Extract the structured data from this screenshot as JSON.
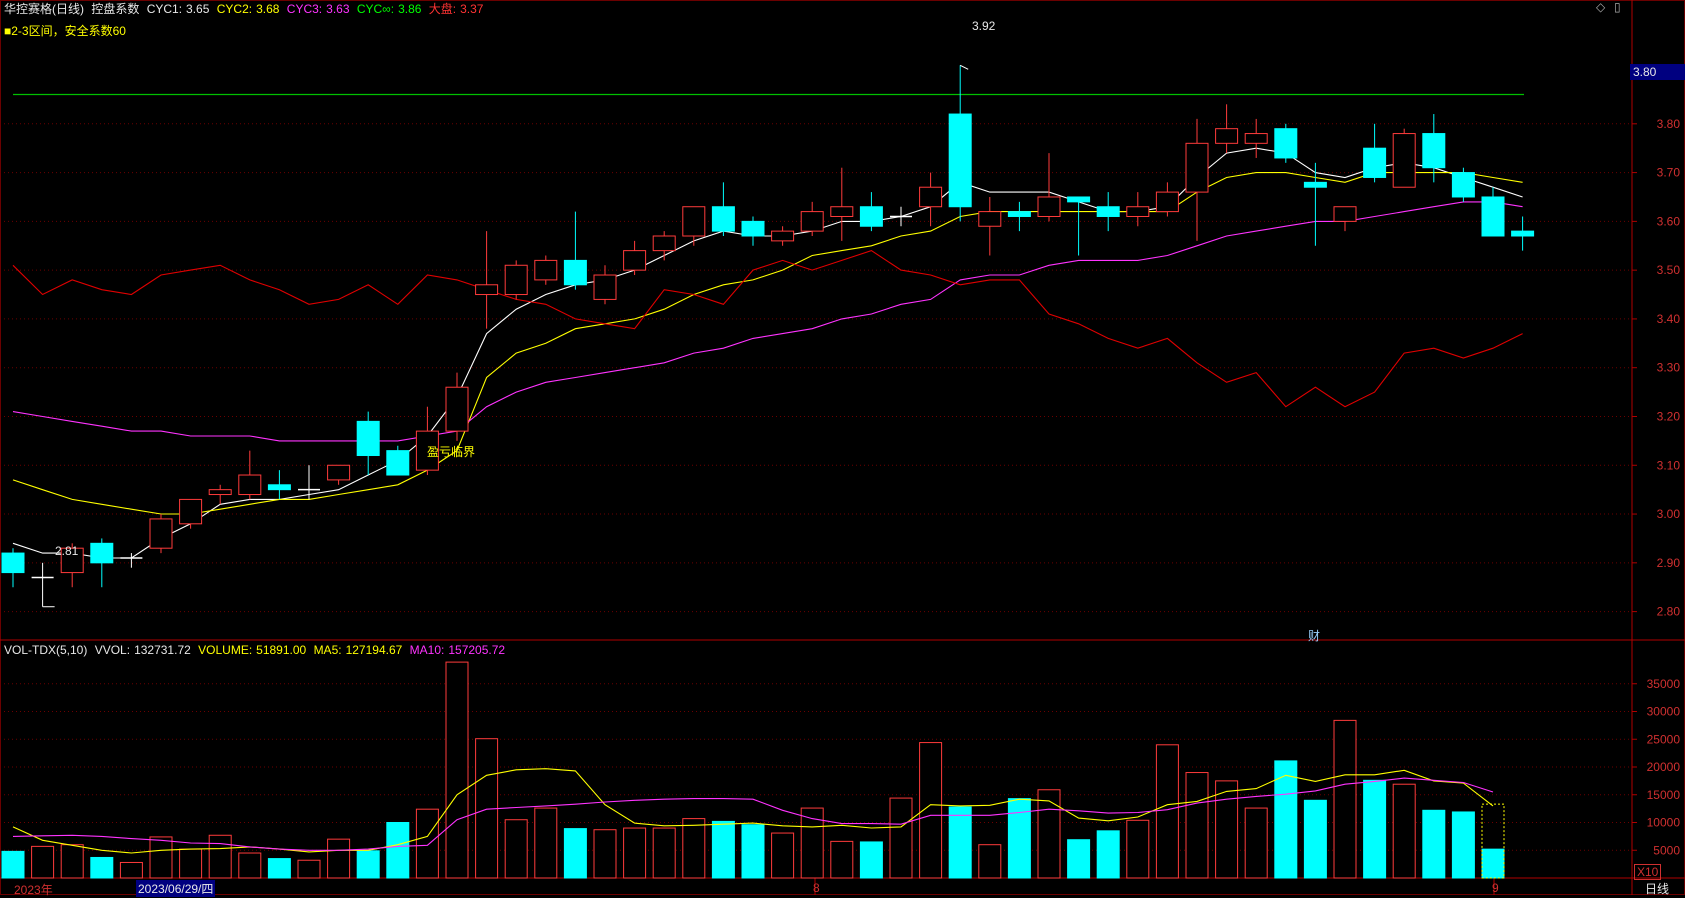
{
  "header": {
    "stock": "华控赛格(日线)",
    "indicator": "控盘系数",
    "cyc1_label": "CYC1:",
    "cyc1": "3.65",
    "cyc2_label": "CYC2:",
    "cyc2": "3.68",
    "cyc3_label": "CYC3:",
    "cyc3": "3.63",
    "cycinf_label": "CYC∞:",
    "cycinf": "3.86",
    "dapan_label": "大盘:",
    "dapan": "3.37",
    "zone_note": "■2-3区间，安全系数60"
  },
  "vol_header": {
    "name": "VOL-TDX(5,10)",
    "vvol_label": "VVOL:",
    "vvol": "132731.72",
    "volume_label": "VOLUME:",
    "volume": "51891.00",
    "ma5_label": "MA5:",
    "ma5": "127194.67",
    "ma10_label": "MA10:",
    "ma10": "157205.72"
  },
  "annotations": {
    "breakeven": "盈亏临界",
    "high_label": "3.92",
    "low_label": "2.81",
    "cai": "财",
    "price_tag": "3.80",
    "x10": "X10",
    "period": "日线",
    "year": "2023年",
    "cursor_date": "2023/06/29/四",
    "month_8": "8",
    "month_9": "9"
  },
  "colors": {
    "up": "#ff3b3b",
    "down": "#00ffff",
    "ma5": "#ffffff",
    "ma10": "#ffff00",
    "ma_long": "#ff33ff",
    "index": "#e00000",
    "hline": "#00c000",
    "grid": "#6b0000",
    "axis_text": "#d03030"
  },
  "chart_data": [
    {
      "type": "candlestick",
      "title": "",
      "ylim": [
        2.75,
        3.98
      ],
      "y_ticks": [
        2.8,
        2.9,
        3.0,
        3.1,
        3.2,
        3.3,
        3.4,
        3.5,
        3.6,
        3.7,
        3.8
      ],
      "reference_line": 3.86,
      "candles": [
        {
          "o": 2.92,
          "h": 2.93,
          "l": 2.85,
          "c": 2.88
        },
        {
          "o": 2.87,
          "h": 2.9,
          "l": 2.81,
          "c": 2.87
        },
        {
          "o": 2.88,
          "h": 2.94,
          "l": 2.85,
          "c": 2.93
        },
        {
          "o": 2.94,
          "h": 2.95,
          "l": 2.85,
          "c": 2.9
        },
        {
          "o": 2.91,
          "h": 2.92,
          "l": 2.89,
          "c": 2.91
        },
        {
          "o": 2.93,
          "h": 3.0,
          "l": 2.92,
          "c": 2.99
        },
        {
          "o": 2.98,
          "h": 3.03,
          "l": 2.97,
          "c": 3.03
        },
        {
          "o": 3.04,
          "h": 3.06,
          "l": 3.02,
          "c": 3.05
        },
        {
          "o": 3.04,
          "h": 3.13,
          "l": 3.03,
          "c": 3.08
        },
        {
          "o": 3.06,
          "h": 3.09,
          "l": 3.03,
          "c": 3.05
        },
        {
          "o": 3.05,
          "h": 3.1,
          "l": 3.03,
          "c": 3.05
        },
        {
          "o": 3.07,
          "h": 3.1,
          "l": 3.06,
          "c": 3.1
        },
        {
          "o": 3.19,
          "h": 3.21,
          "l": 3.08,
          "c": 3.12
        },
        {
          "o": 3.13,
          "h": 3.14,
          "l": 3.08,
          "c": 3.08
        },
        {
          "o": 3.09,
          "h": 3.22,
          "l": 3.08,
          "c": 3.17
        },
        {
          "o": 3.17,
          "h": 3.29,
          "l": 3.15,
          "c": 3.26
        },
        {
          "o": 3.45,
          "h": 3.58,
          "l": 3.38,
          "c": 3.47
        },
        {
          "o": 3.45,
          "h": 3.52,
          "l": 3.44,
          "c": 3.51
        },
        {
          "o": 3.48,
          "h": 3.53,
          "l": 3.47,
          "c": 3.52
        },
        {
          "o": 3.52,
          "h": 3.62,
          "l": 3.46,
          "c": 3.47
        },
        {
          "o": 3.44,
          "h": 3.51,
          "l": 3.43,
          "c": 3.49
        },
        {
          "o": 3.5,
          "h": 3.56,
          "l": 3.49,
          "c": 3.54
        },
        {
          "o": 3.54,
          "h": 3.58,
          "l": 3.52,
          "c": 3.57
        },
        {
          "o": 3.57,
          "h": 3.63,
          "l": 3.55,
          "c": 3.63
        },
        {
          "o": 3.63,
          "h": 3.68,
          "l": 3.57,
          "c": 3.58
        },
        {
          "o": 3.6,
          "h": 3.61,
          "l": 3.55,
          "c": 3.57
        },
        {
          "o": 3.56,
          "h": 3.59,
          "l": 3.55,
          "c": 3.58
        },
        {
          "o": 3.58,
          "h": 3.64,
          "l": 3.57,
          "c": 3.62
        },
        {
          "o": 3.61,
          "h": 3.71,
          "l": 3.56,
          "c": 3.63
        },
        {
          "o": 3.63,
          "h": 3.66,
          "l": 3.58,
          "c": 3.59
        },
        {
          "o": 3.61,
          "h": 3.63,
          "l": 3.59,
          "c": 3.61
        },
        {
          "o": 3.63,
          "h": 3.7,
          "l": 3.59,
          "c": 3.67
        },
        {
          "o": 3.82,
          "h": 3.92,
          "l": 3.6,
          "c": 3.63
        },
        {
          "o": 3.59,
          "h": 3.65,
          "l": 3.53,
          "c": 3.62
        },
        {
          "o": 3.62,
          "h": 3.64,
          "l": 3.58,
          "c": 3.61
        },
        {
          "o": 3.61,
          "h": 3.74,
          "l": 3.6,
          "c": 3.65
        },
        {
          "o": 3.65,
          "h": 3.65,
          "l": 3.53,
          "c": 3.64
        },
        {
          "o": 3.63,
          "h": 3.66,
          "l": 3.58,
          "c": 3.61
        },
        {
          "o": 3.61,
          "h": 3.66,
          "l": 3.59,
          "c": 3.63
        },
        {
          "o": 3.62,
          "h": 3.68,
          "l": 3.61,
          "c": 3.66
        },
        {
          "o": 3.66,
          "h": 3.81,
          "l": 3.56,
          "c": 3.76
        },
        {
          "o": 3.76,
          "h": 3.84,
          "l": 3.74,
          "c": 3.79
        },
        {
          "o": 3.76,
          "h": 3.81,
          "l": 3.73,
          "c": 3.78
        },
        {
          "o": 3.79,
          "h": 3.8,
          "l": 3.72,
          "c": 3.73
        },
        {
          "o": 3.68,
          "h": 3.72,
          "l": 3.55,
          "c": 3.67
        },
        {
          "o": 3.6,
          "h": 3.63,
          "l": 3.58,
          "c": 3.63
        },
        {
          "o": 3.75,
          "h": 3.8,
          "l": 3.68,
          "c": 3.69
        },
        {
          "o": 3.67,
          "h": 3.79,
          "l": 3.67,
          "c": 3.78
        },
        {
          "o": 3.78,
          "h": 3.82,
          "l": 3.68,
          "c": 3.71
        },
        {
          "o": 3.7,
          "h": 3.71,
          "l": 3.64,
          "c": 3.65
        },
        {
          "o": 3.65,
          "h": 3.67,
          "l": 3.58,
          "c": 3.57
        },
        {
          "o": 3.58,
          "h": 3.61,
          "l": 3.54,
          "c": 3.57
        }
      ],
      "series": [
        {
          "name": "CYC1",
          "values": [
            2.94,
            2.92,
            2.92,
            2.91,
            2.91,
            2.95,
            2.98,
            3.02,
            3.03,
            3.03,
            3.04,
            3.05,
            3.08,
            3.11,
            3.16,
            3.24,
            3.37,
            3.42,
            3.45,
            3.47,
            3.48,
            3.5,
            3.53,
            3.56,
            3.58,
            3.57,
            3.57,
            3.58,
            3.6,
            3.6,
            3.61,
            3.63,
            3.68,
            3.66,
            3.66,
            3.66,
            3.64,
            3.62,
            3.62,
            3.63,
            3.69,
            3.74,
            3.75,
            3.74,
            3.7,
            3.69,
            3.71,
            3.72,
            3.71,
            3.69,
            3.67,
            3.65
          ]
        },
        {
          "name": "CYC2",
          "values": [
            3.07,
            3.05,
            3.03,
            3.02,
            3.01,
            3.0,
            3.0,
            3.01,
            3.02,
            3.03,
            3.03,
            3.04,
            3.05,
            3.06,
            3.09,
            3.13,
            3.28,
            3.33,
            3.35,
            3.38,
            3.39,
            3.4,
            3.42,
            3.45,
            3.47,
            3.48,
            3.5,
            3.53,
            3.54,
            3.55,
            3.57,
            3.58,
            3.61,
            3.62,
            3.62,
            3.62,
            3.62,
            3.62,
            3.62,
            3.62,
            3.66,
            3.69,
            3.7,
            3.7,
            3.69,
            3.68,
            3.7,
            3.7,
            3.7,
            3.7,
            3.69,
            3.68
          ]
        },
        {
          "name": "CYC3",
          "values": [
            3.21,
            3.2,
            3.19,
            3.18,
            3.17,
            3.17,
            3.16,
            3.16,
            3.16,
            3.15,
            3.15,
            3.15,
            3.15,
            3.15,
            3.16,
            3.17,
            3.22,
            3.25,
            3.27,
            3.28,
            3.29,
            3.3,
            3.31,
            3.33,
            3.34,
            3.36,
            3.37,
            3.38,
            3.4,
            3.41,
            3.43,
            3.44,
            3.48,
            3.49,
            3.49,
            3.51,
            3.52,
            3.52,
            3.52,
            3.53,
            3.55,
            3.57,
            3.58,
            3.59,
            3.6,
            3.6,
            3.61,
            3.62,
            3.63,
            3.64,
            3.64,
            3.63
          ]
        },
        {
          "name": "大盘",
          "values": [
            3.51,
            3.45,
            3.48,
            3.46,
            3.45,
            3.49,
            3.5,
            3.51,
            3.48,
            3.46,
            3.43,
            3.44,
            3.47,
            3.43,
            3.49,
            3.48,
            3.46,
            3.44,
            3.43,
            3.4,
            3.39,
            3.38,
            3.46,
            3.45,
            3.43,
            3.5,
            3.52,
            3.5,
            3.52,
            3.54,
            3.5,
            3.49,
            3.47,
            3.48,
            3.48,
            3.41,
            3.39,
            3.36,
            3.34,
            3.36,
            3.31,
            3.27,
            3.29,
            3.22,
            3.26,
            3.22,
            3.25,
            3.33,
            3.34,
            3.32,
            3.34,
            3.37
          ]
        }
      ]
    },
    {
      "type": "bar",
      "title": "",
      "ylim": [
        0,
        40000
      ],
      "y_ticks": [
        5000,
        10000,
        15000,
        20000,
        25000,
        30000,
        35000
      ],
      "values": [
        4800,
        5700,
        6000,
        3700,
        2800,
        7400,
        5200,
        7700,
        4500,
        3500,
        3200,
        7000,
        4900,
        10000,
        12400,
        38900,
        25100,
        10500,
        12600,
        8900,
        8700,
        9000,
        9000,
        10700,
        10200,
        9600,
        8100,
        12600,
        6600,
        6500,
        14400,
        24400,
        12800,
        6000,
        14300,
        15900,
        6900,
        8500,
        10400,
        24000,
        19000,
        17500,
        12600,
        21100,
        14000,
        28400,
        17600,
        16900,
        12200,
        11900,
        5200
      ],
      "series": [
        {
          "name": "MA5",
          "values": [
            9200,
            6800,
            5900,
            5000,
            4500,
            5000,
            5200,
            5300,
            5600,
            5200,
            4700,
            5000,
            5000,
            6000,
            7500,
            15000,
            18500,
            19500,
            19700,
            19300,
            13200,
            9900,
            9400,
            9500,
            9700,
            9900,
            9400,
            9200,
            9500,
            9000,
            9200,
            13200,
            13000,
            13100,
            14200,
            13900,
            10800,
            10300,
            11000,
            13200,
            13800,
            15600,
            16100,
            18500,
            17400,
            18600,
            18600,
            19400,
            17500,
            17100,
            13000
          ]
        },
        {
          "name": "MA10",
          "values": [
            7500,
            7600,
            7700,
            7500,
            7100,
            6800,
            6300,
            6200,
            5600,
            5200,
            5000,
            5000,
            5200,
            5700,
            5900,
            10500,
            12400,
            12700,
            13000,
            13300,
            13700,
            14000,
            14200,
            14300,
            14300,
            14200,
            12200,
            10700,
            9800,
            9800,
            9700,
            11300,
            11300,
            11300,
            11800,
            12400,
            12100,
            11700,
            11800,
            12300,
            13500,
            14200,
            14700,
            15100,
            15700,
            16900,
            17400,
            18000,
            17600,
            17200,
            15500
          ]
        }
      ]
    }
  ]
}
